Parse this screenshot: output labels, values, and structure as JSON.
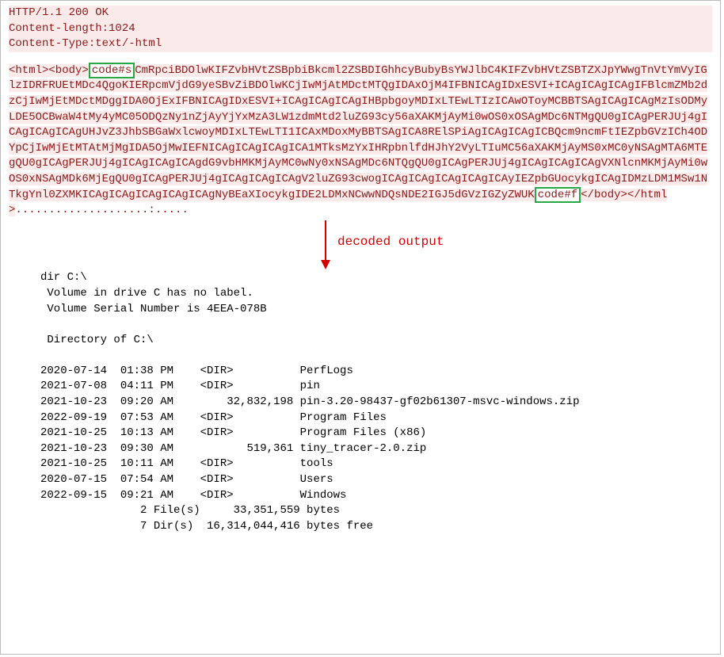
{
  "http": {
    "status_line": "HTTP/1.1 200 OK",
    "content_length": "Content-length:1024",
    "content_type": "Content-Type:text/-html"
  },
  "payload": {
    "open_tags": "<html><body>",
    "start_token": "code#s",
    "b64": "CmRpciBDOlwKIFZvbHVtZSBpbiBkcml2ZSBDIGhhcyBubyBsYWJlbC4KIFZvbHVtZSBTZXJpYWwgTnVtYmVyIGlzIDRFRUEtMDc4QgoKIERpcmVjdG9yeSBvZiBDOlwKCjIwMjAtMDctMTQgIDAxOjM4IFBNICAgIDxESVI+ICAgICAgICAgIFBlcmZMb2dzCjIwMjEtMDctMDggIDA0OjExIFBNICAgIDxESVI+ICAgICAgICAgIHBpbgoyMDIxLTEwLTIzICAwOToyMCBBTSAgICAgICAgMzIsODMyLDE5OCBwaW4tMy4yMC05ODQzNy1nZjAyYjYxMzA3LW1zdmMtd2luZG93cy56aXAKMjAyMi0wOS0xOSAgMDc6NTMgQU0gICAgPERJUj4gICAgICAgICAgUHJvZ3JhbSBGaWxlcwoyMDIxLTEwLTI1ICAxMDoxMyBBTSAgICA8RElSPiAgICAgICAgICBQcm9ncmFtIEZpbGVzICh4ODYpCjIwMjEtMTAtMjMgIDA5OjMwIEFNICAgICAgICAgICA1MTksMzYxIHRpbnlfdHJhY2VyLTIuMC56aXAKMjAyMS0xMC0yNSAgMTA6MTEgQU0gICAgPERJUj4gICAgICAgICAgdG9vbHMKMjAyMC0wNy0xNSAgMDc6NTQgQU0gICAgPERJUj4gICAgICAgICAgVXNlcnMKMjAyMi0wOS0xNSAgMDk6MjEgQU0gICAgPERJUj4gICAgICAgICAgV2luZG93cwogICAgICAgICAgICAgICAyIEZpbGUocykgICAgIDMzLDM1MSw1NTkgYnl0ZXMKICAgICAgICAgICAgICAgNyBEaXIocykgIDE2LDMxNCwwNDQsNDE2IGJ5dGVzIGZyZWUK",
    "end_token": "code#f",
    "close_tags": "</body></html>",
    "trailing": "....................:....."
  },
  "annotation": {
    "arrow_label": "decoded output"
  },
  "decoded": {
    "line01": "dir C:\\",
    "line02": " Volume in drive C has no label.",
    "line03": " Volume Serial Number is 4EEA-078B",
    "line04": "",
    "line05": " Directory of C:\\",
    "line06": "",
    "line07": "2020-07-14  01:38 PM    <DIR>          PerfLogs",
    "line08": "2021-07-08  04:11 PM    <DIR>          pin",
    "line09": "2021-10-23  09:20 AM        32,832,198 pin-3.20-98437-gf02b61307-msvc-windows.zip",
    "line10": "2022-09-19  07:53 AM    <DIR>          Program Files",
    "line11": "2021-10-25  10:13 AM    <DIR>          Program Files (x86)",
    "line12": "2021-10-23  09:30 AM           519,361 tiny_tracer-2.0.zip",
    "line13": "2021-10-25  10:11 AM    <DIR>          tools",
    "line14": "2020-07-15  07:54 AM    <DIR>          Users",
    "line15": "2022-09-15  09:21 AM    <DIR>          Windows",
    "line16": "               2 File(s)     33,351,559 bytes",
    "line17": "               7 Dir(s)  16,314,044,416 bytes free"
  }
}
